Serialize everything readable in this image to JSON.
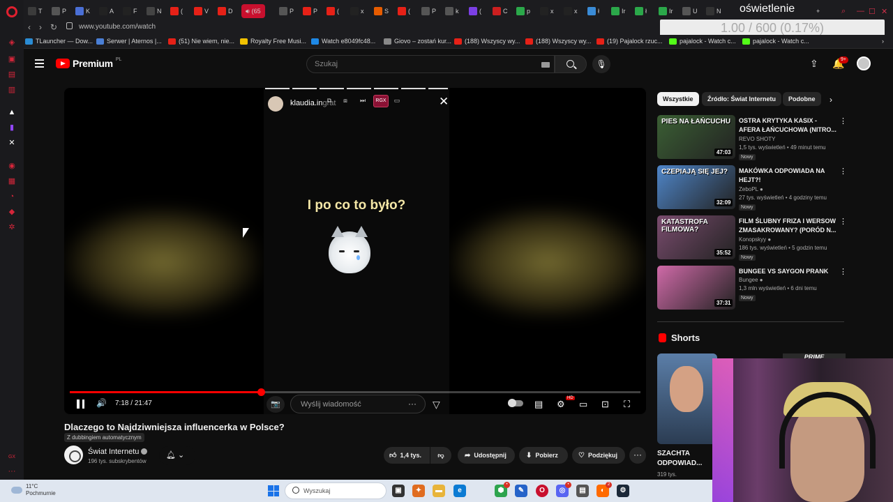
{
  "browser": {
    "page_title_overlay": "oświetlenie",
    "counter": "1.00 / 600 (0.17%)",
    "url": "www.youtube.com/watch",
    "tabs": [
      {
        "fav": "T",
        "label": "T",
        "color": "#3b3b3b"
      },
      {
        "fav": "P",
        "label": "P",
        "color": "#555"
      },
      {
        "fav": "K",
        "label": "K",
        "color": "#4a6fd6"
      },
      {
        "fav": "A",
        "label": "A",
        "color": "#222"
      },
      {
        "fav": "F",
        "label": "F",
        "color": "#222"
      },
      {
        "fav": "N",
        "label": "N",
        "color": "#444"
      },
      {
        "fav": "(",
        "label": "(",
        "color": "#e62117"
      },
      {
        "fav": "V",
        "label": "V",
        "color": "#e62117"
      },
      {
        "fav": "D",
        "label": "D",
        "color": "#e62117"
      },
      {
        "fav": "P",
        "label": "P",
        "color": "#555"
      },
      {
        "fav": "P",
        "label": "P",
        "color": "#e62117"
      },
      {
        "fav": "(",
        "label": "(",
        "color": "#e62117"
      },
      {
        "fav": "x",
        "label": "x",
        "color": "#222"
      },
      {
        "fav": "S",
        "label": "S",
        "color": "#e65c00"
      },
      {
        "fav": "(",
        "label": "(",
        "color": "#e62117"
      },
      {
        "fav": "P",
        "label": "P",
        "color": "#555"
      },
      {
        "fav": "k",
        "label": "k",
        "color": "#555"
      },
      {
        "fav": "(",
        "label": "(",
        "color": "#7b3fe4"
      },
      {
        "fav": "C",
        "label": "C",
        "color": "#cc1f1f"
      },
      {
        "fav": "p",
        "label": "p",
        "color": "#2ba84a"
      },
      {
        "fav": "x",
        "label": "x",
        "color": "#222"
      },
      {
        "fav": "x",
        "label": "x",
        "color": "#222"
      },
      {
        "fav": "ł",
        "label": "ł",
        "color": "#3a8bd6"
      },
      {
        "fav": "Ir",
        "label": "Ir",
        "color": "#2ba84a"
      },
      {
        "fav": "ł",
        "label": "ł",
        "color": "#2ba84a"
      },
      {
        "fav": "Ir",
        "label": "Ir",
        "color": "#2ba84a"
      },
      {
        "fav": "U",
        "label": "U",
        "color": "#555"
      },
      {
        "fav": "N",
        "label": "N",
        "color": "#333"
      }
    ],
    "active_tab": {
      "label": "(65",
      "muted_icon": "speaker-icon"
    },
    "bookmarks": [
      {
        "label": "TLauncher — Dow...",
        "color": "#2a8cd4"
      },
      {
        "label": "Serwer | Aternos |...",
        "color": "#4a7fd6"
      },
      {
        "label": "(51) Nie wiem, nie...",
        "color": "#e62117"
      },
      {
        "label": "Royalty Free Musi...",
        "color": "#f2c200"
      },
      {
        "label": "Watch e8049fc48...",
        "color": "#1e88e5"
      },
      {
        "label": "Giovo – zostań kur...",
        "color": "#888"
      },
      {
        "label": "(188) Wszyscy wy...",
        "color": "#e62117"
      },
      {
        "label": "(188) Wszyscy wy...",
        "color": "#e62117"
      },
      {
        "label": "(19) Pajalock rzuc...",
        "color": "#e62117"
      },
      {
        "label": "pajalock - Watch c...",
        "color": "#53fc18"
      },
      {
        "label": "pajalock - Watch c...",
        "color": "#53fc18"
      }
    ]
  },
  "yt": {
    "logo_text": "Premium",
    "logo_country": "PL",
    "search_placeholder": "Szukaj",
    "bell_badge": "9+"
  },
  "player": {
    "overlay_username": "klaudia.in",
    "overlay_username_suffix": "grat",
    "rgx_label": "RGX",
    "caption": "I po co to było?",
    "time_current": "7:18",
    "time_sep": " / ",
    "time_total": "21:47",
    "progress_fraction": 0.335,
    "chat_placeholder": "Wyślij wiadomość",
    "hd_badge": "HD"
  },
  "video": {
    "title": "Dlaczego to Najdziwniejsza influencerka w Polsce?",
    "dub_label": "Z dubbingiem automatycznym",
    "channel_name": "Świat Internetu",
    "subscribers": "196 tys. subskrybentów",
    "likes": "1,4 tys.",
    "share_label": "Udostępnij",
    "download_label": "Pobierz",
    "thanks_label": "Podziękuj"
  },
  "sidebar": {
    "chips": [
      "Wszystkie",
      "Źródło: Świat Internetu",
      "Podobne"
    ],
    "recommendations": [
      {
        "title": "OSTRA KRYTYKA KASIX - AFERA ŁAŃCUCHOWA (NITRO...",
        "channel": "REVO SHOTY",
        "meta": "1,5 tys. wyświetleń • 49 minut temu",
        "badge": "Nowy",
        "duration": "47:03",
        "thumb_text": "PIES NA ŁAŃCUCHU",
        "thumb_color": "#3b5f34",
        "verified": false
      },
      {
        "title": "MAKÓWKA ODPOWIADA NA HEJT?!",
        "channel": "ZeboPL",
        "meta": "27 tys. wyświetleń • 4 godziny temu",
        "badge": "Nowy",
        "duration": "32:09",
        "thumb_text": "CZEPIAJĄ SIĘ JEJ?",
        "thumb_color": "#4f86c9",
        "verified": true
      },
      {
        "title": "FILM ŚLUBNY FRIZA I WERSOW ZMASAKROWANY? (PORÓD N...",
        "channel": "Konopskyy",
        "meta": "186 tys. wyświetleń • 5 godzin temu",
        "badge": "Nowy",
        "duration": "35:52",
        "thumb_text": "KATASTROFA FILMOWA?",
        "thumb_color": "#7a4c6e",
        "verified": true
      },
      {
        "title": "BUNGEE VS SAYGON PRANK",
        "channel": "Bungee",
        "meta": "1,3 mln wyświetleń • 6 dni temu",
        "badge": "Nowy",
        "duration": "37:31",
        "thumb_text": "",
        "thumb_color": "#d06aa8",
        "verified": true
      }
    ],
    "shorts_heading": "Shorts",
    "short1_title": "SZACHTA ODPOWIAD...",
    "short1_views": "319 tys.",
    "short2_label": "PRIME"
  },
  "taskbar": {
    "temp": "11°C",
    "weather": "Pochmurnie",
    "search_placeholder": "Wyszukaj"
  },
  "colors": {
    "accent": "#ff0000",
    "opera_red": "#c8102e"
  }
}
